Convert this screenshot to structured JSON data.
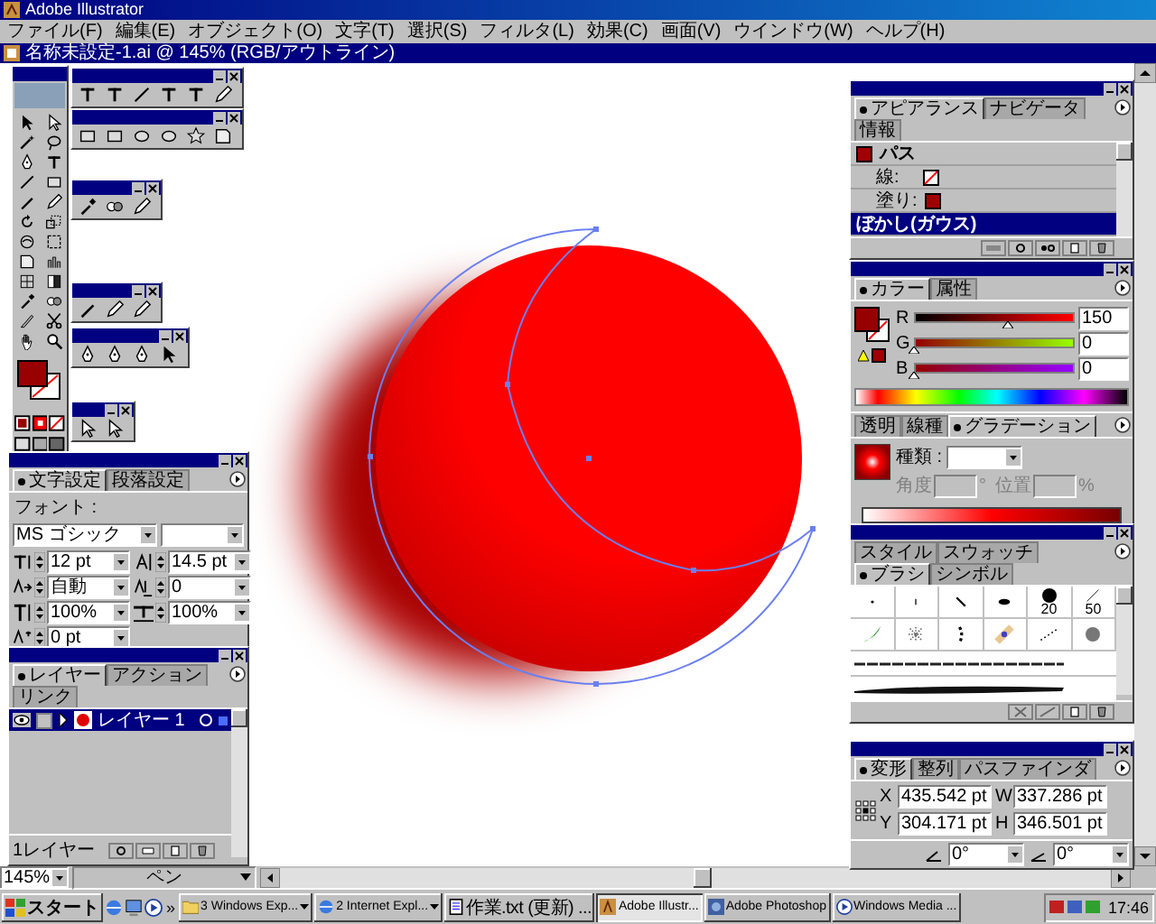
{
  "app": {
    "title": "Adobe Illustrator"
  },
  "menu": [
    "ファイル(F)",
    "編集(E)",
    "オブジェクト(O)",
    "文字(T)",
    "選択(S)",
    "フィルタ(L)",
    "効果(C)",
    "画面(V)",
    "ウインドウ(W)",
    "ヘルプ(H)"
  ],
  "document": {
    "title": "名称未設定-1.ai @ 145% (RGB/アウトライン)",
    "zoom": "145%",
    "tool": "ペン"
  },
  "character_panel": {
    "tabs": [
      {
        "label": "文字設定",
        "selected": true
      },
      {
        "label": "段落設定",
        "selected": false
      }
    ],
    "font_label": "フォント :",
    "font": "MS ゴシック",
    "fields": [
      {
        "kind": "size",
        "value": "12 pt"
      },
      {
        "kind": "leading",
        "value": "14.5 pt"
      },
      {
        "kind": "tracking",
        "value": "自動"
      },
      {
        "kind": "kerning",
        "value": "0"
      },
      {
        "kind": "vscale",
        "value": "100%"
      },
      {
        "kind": "hscale",
        "value": "100%"
      },
      {
        "kind": "baseline",
        "value": "0 pt"
      }
    ]
  },
  "layers_panel": {
    "tabs": [
      {
        "label": "レイヤー",
        "selected": true
      },
      {
        "label": "アクション",
        "selected": false
      },
      {
        "label": "リンク",
        "selected": false
      }
    ],
    "layers": [
      {
        "name": "レイヤー 1",
        "selected": true
      }
    ],
    "count": "1レイヤー"
  },
  "appearance_panel": {
    "tabs": [
      {
        "label": "アピアランス",
        "selected": true
      },
      {
        "label": "ナビゲータ",
        "selected": false
      },
      {
        "label": "情報",
        "selected": false
      }
    ],
    "items": [
      {
        "kind": "object",
        "label": "パス",
        "selected": false
      },
      {
        "kind": "stroke",
        "label": "線:",
        "selected": false
      },
      {
        "kind": "fill",
        "label": "塗り:",
        "selected": false
      },
      {
        "kind": "effect",
        "label": "ぼかし(ガウス)",
        "selected": true
      }
    ]
  },
  "color_panel": {
    "tabs": [
      {
        "label": "カラー",
        "selected": true
      },
      {
        "label": "属性",
        "selected": false
      }
    ],
    "channels": [
      {
        "name": "R",
        "value": "150",
        "level": 0.588
      },
      {
        "name": "G",
        "value": "0",
        "level": 0
      },
      {
        "name": "B",
        "value": "0",
        "level": 0
      }
    ]
  },
  "gradient_panel": {
    "tabs": [
      {
        "label": "透明",
        "selected": false
      },
      {
        "label": "線種",
        "selected": false
      },
      {
        "label": "グラデーション",
        "selected": true
      }
    ],
    "type_label": "種類 :",
    "fields": [
      {
        "label": "角度",
        "unit": "°",
        "disabled": true
      },
      {
        "label": "位置",
        "unit": "%",
        "disabled": true
      }
    ]
  },
  "brushes_panel": {
    "tabs": [
      {
        "label": "スタイル",
        "selected": false
      },
      {
        "label": "スウォッチ",
        "selected": false
      },
      {
        "label": "ブラシ",
        "selected": true
      },
      {
        "label": "シンボル",
        "selected": false
      }
    ],
    "size_labels": [
      "20",
      "50"
    ]
  },
  "transform_panel": {
    "tabs": [
      {
        "label": "変形",
        "selected": true
      },
      {
        "label": "整列",
        "selected": false
      },
      {
        "label": "パスファインダ",
        "selected": false
      }
    ],
    "fields": [
      {
        "label": "X",
        "value": "435.542 pt"
      },
      {
        "label": "W",
        "value": "337.286 pt"
      },
      {
        "label": "Y",
        "value": "304.171 pt"
      },
      {
        "label": "H",
        "value": "346.501 pt"
      }
    ],
    "rotate": "0°",
    "shear": "0°"
  },
  "taskbar": {
    "start": "スタート",
    "more": "»",
    "buttons": [
      {
        "kind": "folder",
        "label": "3 Windows Exp...",
        "group": true,
        "selected": false
      },
      {
        "kind": "browser",
        "label": "2 Internet Expl...",
        "group": true,
        "selected": false
      },
      {
        "kind": "text",
        "label": "作業.txt (更新) ...",
        "group": false,
        "selected": false
      },
      {
        "kind": "illustrator",
        "label": "Adobe Illustr...",
        "group": false,
        "selected": true
      },
      {
        "kind": "photoshop",
        "label": "Adobe Photoshop",
        "group": false,
        "selected": false
      },
      {
        "kind": "media",
        "label": "Windows Media ...",
        "group": false,
        "selected": false
      }
    ],
    "clock": "17:46"
  }
}
